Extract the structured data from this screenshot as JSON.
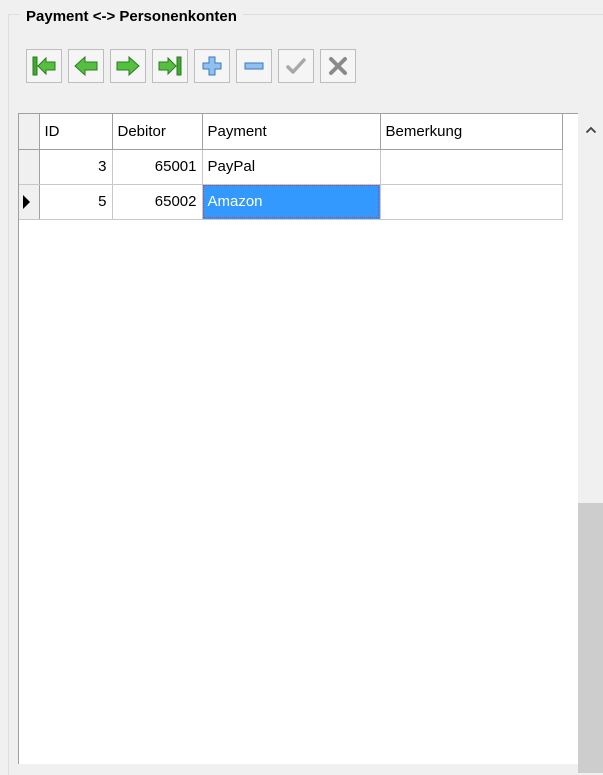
{
  "group": {
    "title": "Payment <-> Personenkonten"
  },
  "toolbar": {
    "buttons": [
      {
        "name": "first-record-button",
        "icon": "first-record-icon",
        "color": "#3faa2e"
      },
      {
        "name": "prior-record-button",
        "icon": "prior-record-icon",
        "color": "#3faa2e"
      },
      {
        "name": "next-record-button",
        "icon": "next-record-icon",
        "color": "#3faa2e"
      },
      {
        "name": "last-record-button",
        "icon": "last-record-icon",
        "color": "#3faa2e"
      },
      {
        "name": "insert-record-button",
        "icon": "plus-icon",
        "color": "#4a8fd8"
      },
      {
        "name": "delete-record-button",
        "icon": "minus-icon",
        "color": "#4a8fd8"
      },
      {
        "name": "post-record-button",
        "icon": "check-icon",
        "color": "#9a9a9a",
        "disabled": true
      },
      {
        "name": "cancel-record-button",
        "icon": "cross-icon",
        "color": "#9a9a9a",
        "disabled": true
      }
    ]
  },
  "grid": {
    "columns": [
      "ID",
      "Debitor",
      "Payment",
      "Bemerkung"
    ],
    "rows": [
      {
        "id": "3",
        "debitor": "65001",
        "payment": "PayPal",
        "bemerkung": ""
      },
      {
        "id": "5",
        "debitor": "65002",
        "payment": "Amazon",
        "bemerkung": ""
      }
    ],
    "selected_color": "#3399ff"
  },
  "scrollbar": {
    "icon": "chevron-up-icon"
  }
}
